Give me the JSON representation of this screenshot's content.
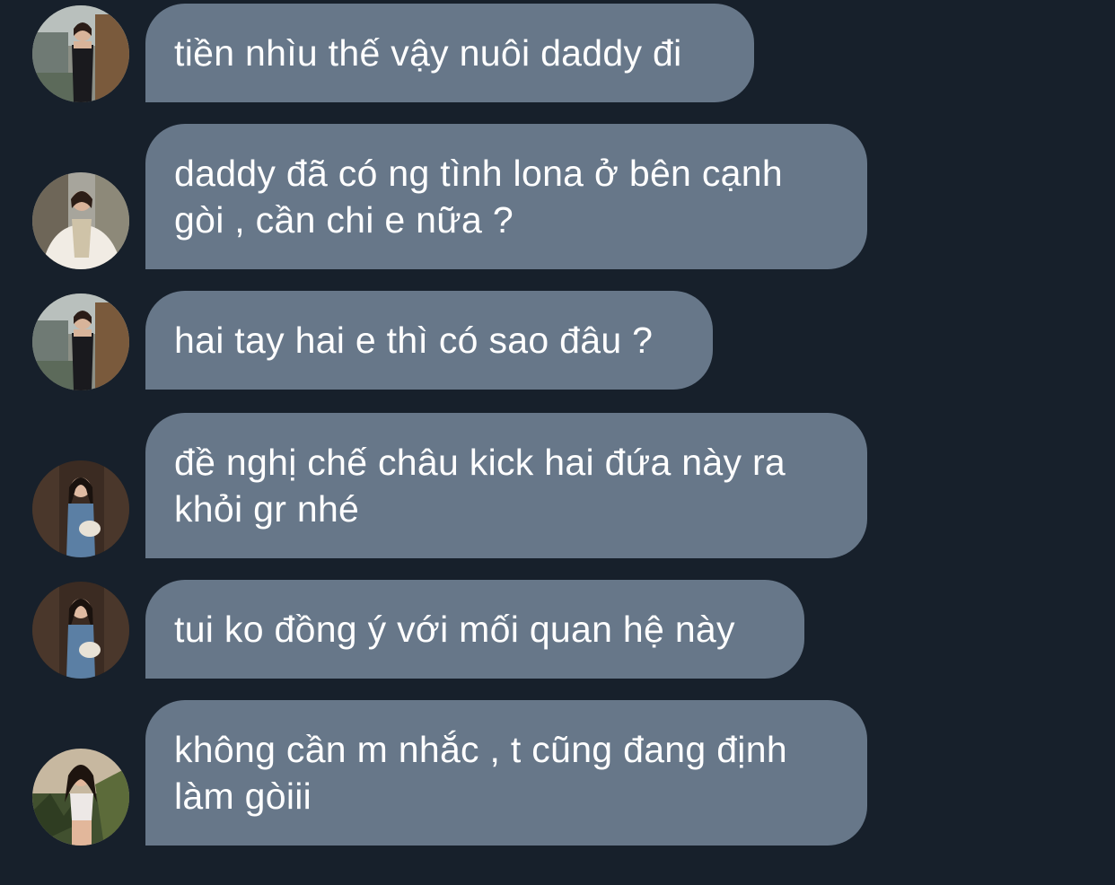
{
  "chat": {
    "messages": [
      {
        "text": "tiền nhìu thế vậy nuôi daddy đi",
        "avatar": "avatar-1"
      },
      {
        "text": "daddy đã có ng tình lona ở bên cạnh\ngòi , cần chi e nữa ?",
        "avatar": "avatar-2"
      },
      {
        "text": "hai tay hai e thì có sao đâu ?",
        "avatar": "avatar-1"
      },
      {
        "text": "đề nghị chế châu kick hai đứa này ra\nkhỏi gr nhé",
        "avatar": "avatar-3"
      },
      {
        "text": "tui ko đồng ý với mối quan hệ này",
        "avatar": "avatar-3"
      },
      {
        "text": "không cần m nhắc , t cũng đang định\nlàm gòiii",
        "avatar": "avatar-4"
      }
    ]
  },
  "colors": {
    "background": "#17202b",
    "bubble": "#677789",
    "text": "#ffffff"
  }
}
